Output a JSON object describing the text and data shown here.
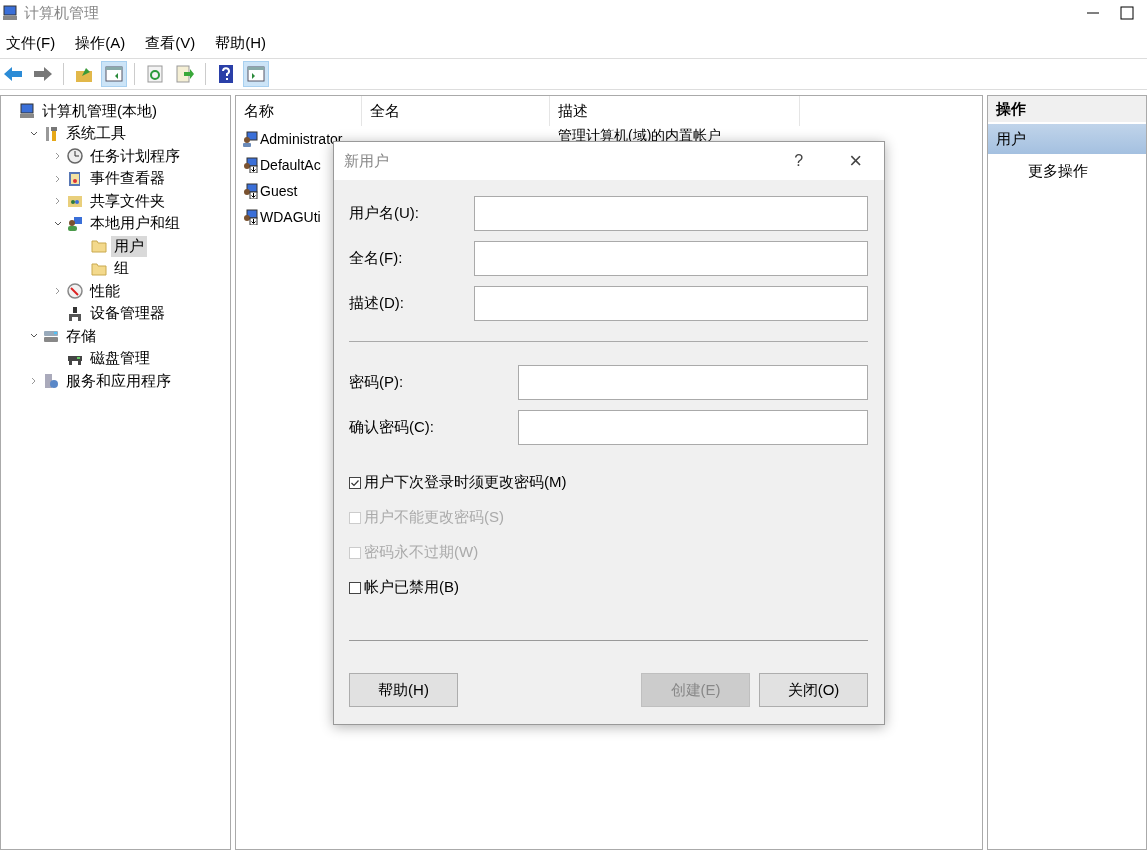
{
  "window": {
    "title": "计算机管理"
  },
  "menu": [
    "文件(F)",
    "操作(A)",
    "查看(V)",
    "帮助(H)"
  ],
  "toolbar": [
    [
      {
        "kind": "back",
        "on": false
      },
      {
        "kind": "forward",
        "on": false
      }
    ],
    [
      {
        "kind": "up",
        "on": false
      },
      {
        "kind": "panel",
        "on": true
      }
    ],
    [
      {
        "kind": "refresh",
        "on": false
      },
      {
        "kind": "export",
        "on": false
      }
    ],
    [
      {
        "kind": "help",
        "on": false
      },
      {
        "kind": "panel-right",
        "on": true
      }
    ]
  ],
  "tree": [
    {
      "label": "计算机管理(本地)",
      "kind": "computer",
      "selected": false,
      "children": [
        {
          "label": "系统工具",
          "kind": "tools",
          "selected": false,
          "expanded": true,
          "children": [
            {
              "label": "任务计划程序",
              "kind": "clock",
              "selected": false,
              "expanded": false
            },
            {
              "label": "事件查看器",
              "kind": "log",
              "selected": false,
              "expanded": false
            },
            {
              "label": "共享文件夹",
              "kind": "share",
              "selected": false,
              "expanded": false
            },
            {
              "label": "本地用户和组",
              "kind": "users",
              "selected": false,
              "expanded": true,
              "children": [
                {
                  "label": "用户",
                  "kind": "folder",
                  "selected": true
                },
                {
                  "label": "组",
                  "kind": "folder",
                  "selected": false
                }
              ]
            },
            {
              "label": "性能",
              "kind": "gauge",
              "selected": false,
              "expanded": false
            },
            {
              "label": "设备管理器",
              "kind": "device",
              "selected": false
            }
          ]
        },
        {
          "label": "存储",
          "kind": "storage",
          "selected": false,
          "expanded": true,
          "children": [
            {
              "label": "磁盘管理",
              "kind": "disk",
              "selected": false
            }
          ]
        },
        {
          "label": "服务和应用程序",
          "kind": "services",
          "selected": false,
          "expanded": false
        }
      ]
    }
  ],
  "list": {
    "columns": [
      "名称",
      "全名",
      "描述"
    ],
    "rows": [
      {
        "name": "Administrator",
        "description": "管理计算机(域)的内置帐户",
        "kind": "admin"
      },
      {
        "name": "DefaultAc",
        "kind": "disabled-user"
      },
      {
        "name": "Guest",
        "kind": "disabled-user"
      },
      {
        "name": "WDAGUti",
        "kind": "disabled-user"
      }
    ]
  },
  "actions": {
    "header": "操作",
    "section": "用户",
    "items": [
      "更多操作"
    ]
  },
  "dialog": {
    "title": "新用户",
    "help_glyph": "?",
    "close_glyph": "×",
    "identity_fields": [
      "用户名(U):",
      "全名(F):",
      "描述(D):"
    ],
    "password_fields": [
      "密码(P):",
      "确认密码(C):"
    ],
    "checkboxes": [
      {
        "label": "用户下次登录时须更改密码(M)",
        "checked": true,
        "disabled": false
      },
      {
        "label": "用户不能更改密码(S)",
        "checked": false,
        "disabled": true
      },
      {
        "label": "密码永不过期(W)",
        "checked": false,
        "disabled": true
      },
      {
        "label": "帐户已禁用(B)",
        "checked": false,
        "disabled": false
      }
    ],
    "left_buttons": [
      {
        "label": "帮助(H)",
        "disabled": false
      }
    ],
    "right_buttons": [
      {
        "label": "创建(E)",
        "disabled": true
      },
      {
        "label": "关闭(O)",
        "disabled": false
      }
    ]
  }
}
